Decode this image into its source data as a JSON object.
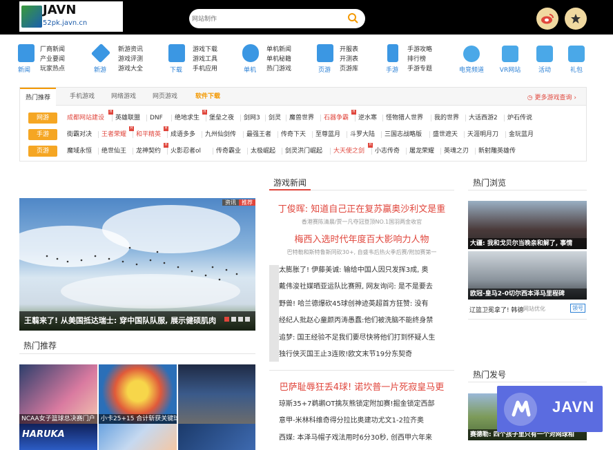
{
  "logo": {
    "title": "JAVN",
    "domain": "52pk.javn.cn"
  },
  "search": {
    "placeholder": "网站制作"
  },
  "nav": [
    {
      "cap": "新闻",
      "links": [
        "厂商新闻",
        "产业要闻",
        "玩家热点"
      ],
      "color": "#2a7fd4"
    },
    {
      "cap": "新游",
      "links": [
        "新游资讯",
        "游戏评测",
        "游戏大全"
      ],
      "color": "#2a7fd4"
    },
    {
      "cap": "下载",
      "links": [
        "游戏下载",
        "游戏工具",
        "手机应用"
      ],
      "color": "#2a7fd4"
    },
    {
      "cap": "单机",
      "links": [
        "单机新闻",
        "单机秘籍",
        "热门游戏"
      ],
      "color": "#2a7fd4"
    },
    {
      "cap": "页游",
      "links": [
        "开服表",
        "开测表",
        "页游库"
      ],
      "color": "#2a7fd4"
    },
    {
      "cap": "手游",
      "links": [
        "手游攻略",
        "排行榜",
        "手游专题"
      ],
      "color": "#2a7fd4"
    }
  ],
  "squares": [
    {
      "cap": "电竞频道",
      "color": "#4aa8e8"
    },
    {
      "cap": "VR网站",
      "color": "#4aa8e8"
    },
    {
      "cap": "活动",
      "color": "#4aa8e8"
    },
    {
      "cap": "礼包",
      "color": "#4aa8e8"
    }
  ],
  "hot": {
    "tabs": [
      "热门推荐",
      "手机游戏",
      "网络游戏",
      "网页游戏",
      "软件下载"
    ],
    "more": "更多游戏查询",
    "rows": [
      {
        "badge": "网游",
        "items": [
          {
            "t": "成都网站建设",
            "red": true,
            "hot": true
          },
          {
            "t": "英雄联盟"
          },
          {
            "t": "DNF"
          },
          {
            "t": "绝地求生",
            "hot": true
          },
          {
            "t": "堡垒之夜"
          },
          {
            "t": "剑网3"
          },
          {
            "t": "剑灵"
          },
          {
            "t": "魔兽世界"
          },
          {
            "t": "石器争霸",
            "red": true,
            "hot": true
          },
          {
            "t": "逆水寒"
          },
          {
            "t": "怪物猎人世界"
          },
          {
            "t": "我的世界"
          },
          {
            "t": "大话西游2"
          },
          {
            "t": "炉石传说"
          }
        ]
      },
      {
        "badge": "手游",
        "items": [
          {
            "t": "街霸对决"
          },
          {
            "t": "王者荣耀",
            "red": true,
            "hot": true
          },
          {
            "t": "和平精英",
            "red": true,
            "hot": true
          },
          {
            "t": "成语多多"
          },
          {
            "t": "九州仙剑传"
          },
          {
            "t": "最强王者"
          },
          {
            "t": "传奇下天"
          },
          {
            "t": "至尊蓝月"
          },
          {
            "t": "斗罗大陆"
          },
          {
            "t": "三国志战略版"
          },
          {
            "t": "盛世遮天"
          },
          {
            "t": "天涯明月刀"
          },
          {
            "t": "金玩蓝月"
          }
        ]
      },
      {
        "badge": "页游",
        "items": [
          {
            "t": "魔域永恒"
          },
          {
            "t": "绝世仙王"
          },
          {
            "t": "龙神契约",
            "hot": true
          },
          {
            "t": "火影忍者ol"
          },
          {
            "t": "传奇霸业"
          },
          {
            "t": "太极崛起"
          },
          {
            "t": "剑灵洪门崛起"
          },
          {
            "t": "大天使之剑",
            "red": true,
            "hot": true
          },
          {
            "t": "小志传奇"
          },
          {
            "t": "屠龙荣耀"
          },
          {
            "t": "英魂之刃"
          },
          {
            "t": "新射雕英雄传"
          }
        ]
      }
    ]
  },
  "sections": {
    "game_news": "游戏新闻",
    "hot_browse": "热门浏览",
    "hot_recommend": "热门推荐",
    "hot_post": "热门发号"
  },
  "slider": {
    "caption": "王翦来了! 从美国抵达瑞士: 穿中国队队服, 展示健硕肌肉",
    "tag1": "资讯",
    "tag2": "推荐"
  },
  "thumbs": [
    {
      "title": "NCAA女子篮球总决赛门户"
    },
    {
      "title": "小卡25+15 合计斩获关键球"
    },
    {
      "title": ""
    },
    {
      "title": ""
    },
    {
      "title": ""
    },
    {
      "title": ""
    }
  ],
  "headlines": [
    {
      "title": "丁俊晖: 知道自己正在复苏赢奥沙利文是重",
      "sub": "香港赛陈清晨/贾一凡夺冠登顶NO.1国羽两金收官"
    },
    {
      "title": "梅西入选时代年度百大影响力人物",
      "sub": "巴特勒和斯特鲁斯同砍30+, 自盛韦后热火季后赛/附加赛第一"
    }
  ],
  "news_list": [
    "太膨胀了! 伊藤美诚: 输给中国人因只发挥3成, 奥",
    "戴伟浚社媒晒亚运队比赛照, 网友询问: 是不是要去",
    "野兽! 哈兰德爆砍45球创神迹英超首方狂赞: 没有",
    "经纪人批赵心童颜丙涛愚蠢:他们被洗脑不能终身禁",
    "追梦: 国王经验不足我们要尽快将他们打到怀疑人生",
    "独行侠灭国王止3连败!欧文末节19分东契奇"
  ],
  "headline3": {
    "title": "巴萨耻辱狂丢4球! 诺坎普一片死寂皇马更"
  },
  "news_list2": [
    "琼斯35+7鹈鹕OT擒灰熊锁定附加赛!掘金锁定西部",
    "意甲-米林科维奇得分拉比奥建功尤文1-2拉齐奥",
    "西媒: 本泽马帽子戏法用时6分30秒, 创西甲六年来"
  ],
  "right": {
    "img1": "大疆: 我和戈贝尔当晚亲和解了, 事情",
    "img2": "欧冠-皇马2-0切尔西本泽马里程碑",
    "link": "辽篮卫冕拿了! 韩德",
    "link_src": "网站优化",
    "link_btn": "领号",
    "img3": "赛德勒: 四个孩子里只有一个对网球相"
  },
  "watermark": {
    "text": "JAVN"
  }
}
